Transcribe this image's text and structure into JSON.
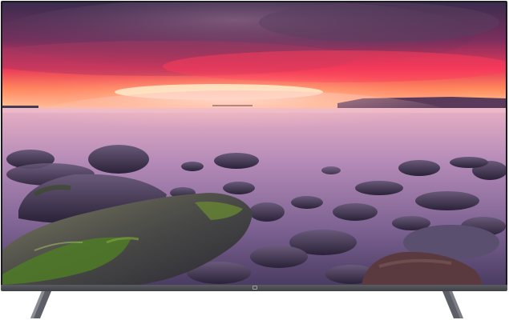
{
  "scene": {
    "subject": "flat-screen-television",
    "screen_content": "sunset-seascape",
    "colors": {
      "bezel": "#1b1b1f",
      "chin": "#4a4c52",
      "stand": "#5c5f66",
      "sky_top": "#3a2a4a",
      "sky_glow": "#ff3b5a",
      "horizon": "#ffd2a0",
      "water": "#c7a3c6",
      "rocks": "#3a3050",
      "moss": "#5d8a2a",
      "background": "#ffffff"
    }
  }
}
